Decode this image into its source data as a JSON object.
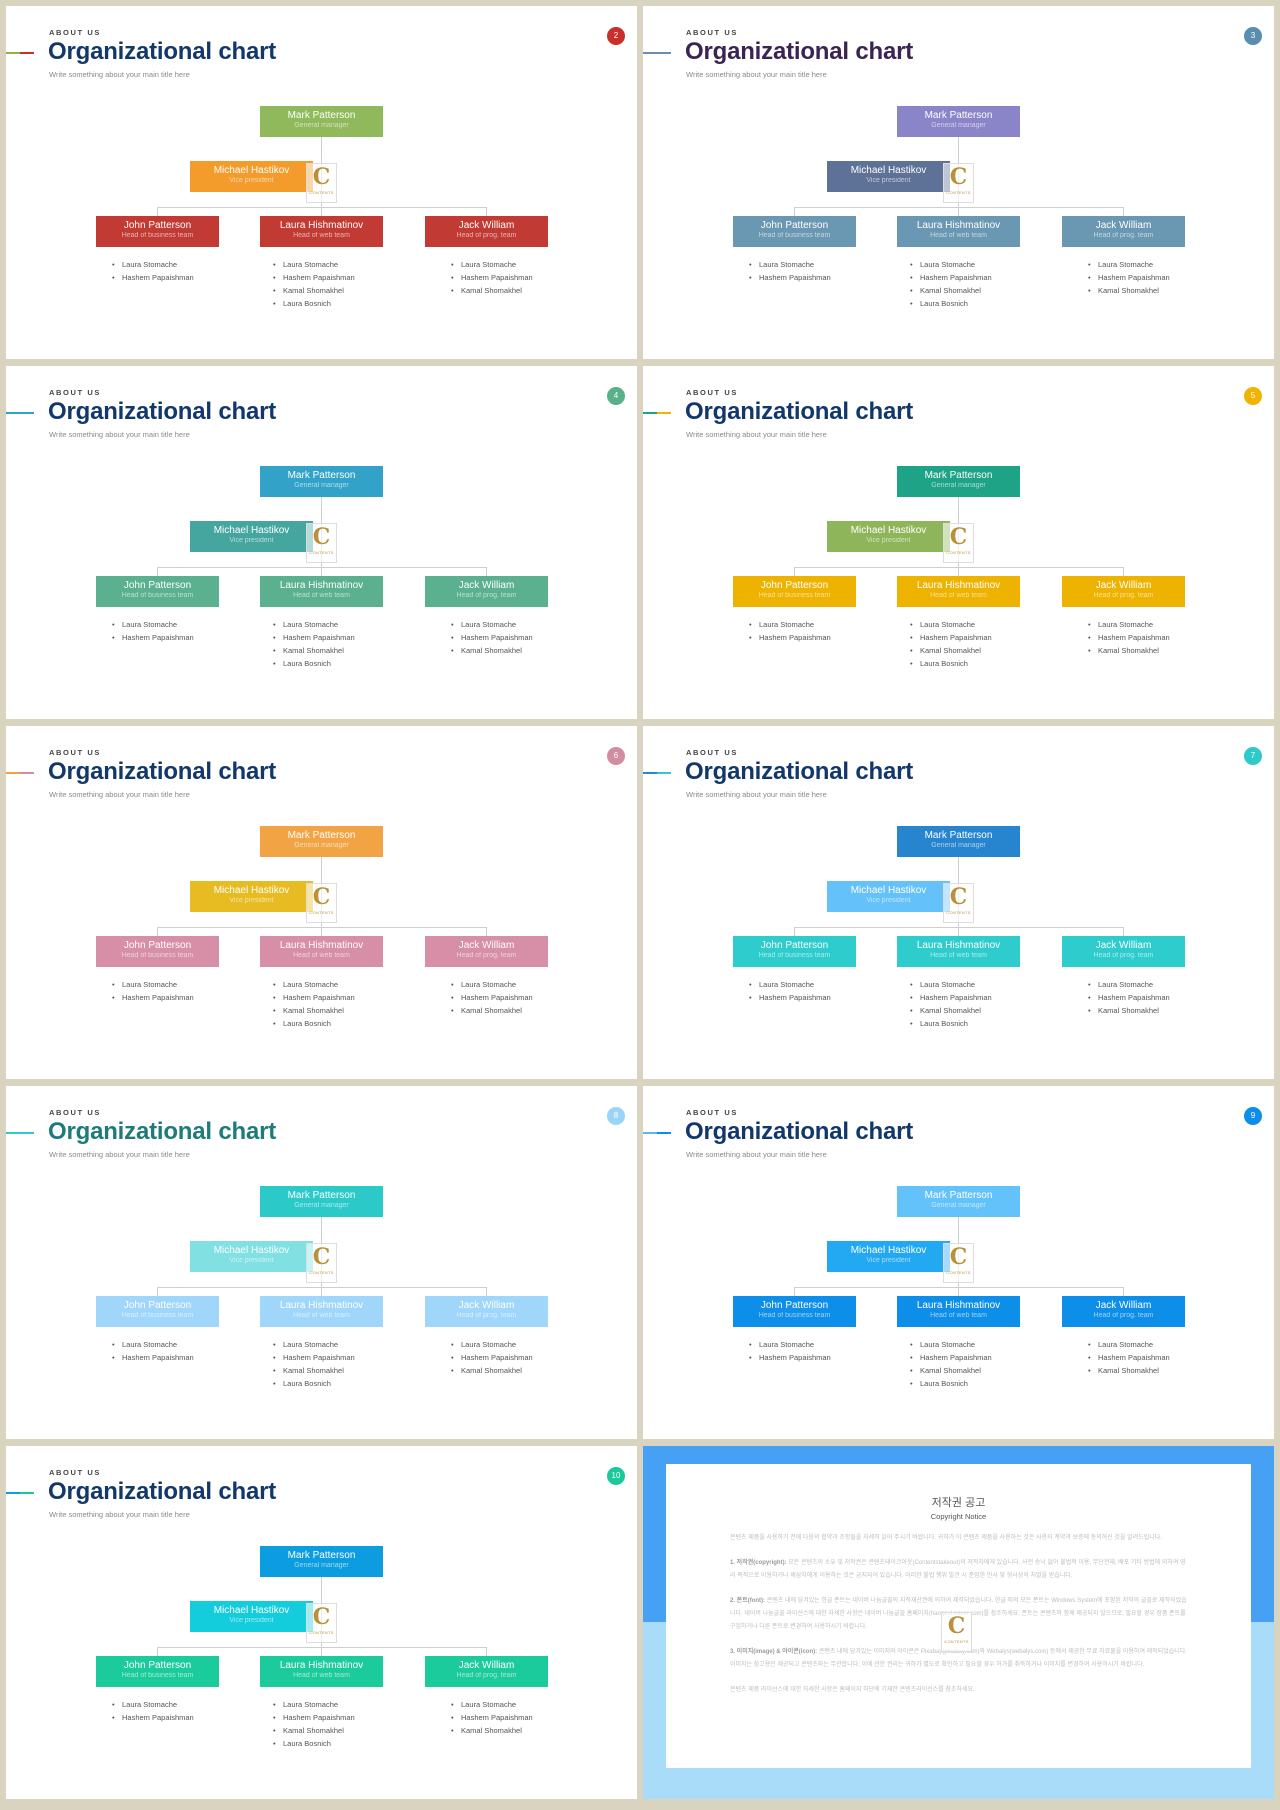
{
  "common": {
    "eyebrow": "ABOUT US",
    "title": "Organizational chart",
    "subtitle": "Write something about your main title here",
    "logo": {
      "icon": "c-monogram-logo",
      "glyph": "C",
      "text": "CONTENTS"
    },
    "org": {
      "general_manager": {
        "name": "Mark Patterson",
        "role": "General manager"
      },
      "vice_president": {
        "name": "Michael Hastikov",
        "role": "Vice president"
      },
      "heads": [
        {
          "name": "John Patterson",
          "role": "Head of business team",
          "members": [
            "Laura Stomache",
            "Hashem Papaishman"
          ]
        },
        {
          "name": "Laura Hishmatinov",
          "role": "Head of web team",
          "members": [
            "Laura Stomache",
            "Hashem Papaishman",
            "Kamal Shomakhel",
            "Laura Bosnich"
          ]
        },
        {
          "name": "Jack William",
          "role": "Head of prog. team",
          "members": [
            "Laura Stomache",
            "Hashem Papaishman",
            "Kamal Shomakhel"
          ]
        }
      ]
    }
  },
  "slides": [
    {
      "page": "2",
      "title_color": "#12386b",
      "badge_color": "#c9302c",
      "accent": [
        "#8fb34a",
        "#c9302c"
      ],
      "gm_color": "#8fb95a",
      "vp_color": "#f39c2c",
      "head_color": "#c13a33"
    },
    {
      "page": "3",
      "title_color": "#3b2352",
      "badge_color": "#5b8db0",
      "accent": [
        "#6a8db0",
        "#6a8db0"
      ],
      "gm_color": "#8a85c9",
      "vp_color": "#5d7296",
      "head_color": "#6a97b2"
    },
    {
      "page": "4",
      "title_color": "#12386b",
      "badge_color": "#5ab08a",
      "accent": [
        "#2fa5c0",
        "#2fa5c0"
      ],
      "gm_color": "#33a2c8",
      "vp_color": "#45a6a0",
      "head_color": "#5ab08f"
    },
    {
      "page": "5",
      "title_color": "#12386b",
      "badge_color": "#f0b400",
      "accent": [
        "#1aa58a",
        "#f0b400"
      ],
      "gm_color": "#1fa386",
      "vp_color": "#8fb55a",
      "head_color": "#eeb200"
    },
    {
      "page": "6",
      "title_color": "#12386b",
      "badge_color": "#d38da3",
      "accent": [
        "#f3a04a",
        "#d38da3"
      ],
      "gm_color": "#f2a444",
      "vp_color": "#e6bc22",
      "head_color": "#d68fa6"
    },
    {
      "page": "7",
      "title_color": "#12386b",
      "badge_color": "#2ec9c9",
      "accent": [
        "#2a86cf",
        "#2ec9c9"
      ],
      "gm_color": "#2785cf",
      "vp_color": "#64c1fa",
      "head_color": "#2ecccc"
    },
    {
      "page": "8",
      "title_color": "#1d7c7a",
      "badge_color": "#9cd4f7",
      "accent": [
        "#34c8c8",
        "#34c8c8"
      ],
      "gm_color": "#2cc9c9",
      "vp_color": "#80e0e2",
      "head_color": "#9fd6f9"
    },
    {
      "page": "9",
      "title_color": "#12386b",
      "badge_color": "#0d8ee8",
      "accent": [
        "#5bb9f0",
        "#0d8ee8"
      ],
      "gm_color": "#64c2fa",
      "vp_color": "#22a9f2",
      "head_color": "#0d8ee8"
    },
    {
      "page": "10",
      "title_color": "#12386b",
      "badge_color": "#19c99a",
      "accent": [
        "#0aa0dd",
        "#19c99a"
      ],
      "gm_color": "#0c9ce0",
      "vp_color": "#14cddc",
      "head_color": "#1ccb9b"
    }
  ],
  "copyright": {
    "title_ko": "저작권 공고",
    "title_en": "Copyright Notice",
    "top_color": "#46a0f3",
    "bottom_color": "#a9dcf8",
    "intro": "콘텐츠 제품을 사용하기 전에 다음의 협약과 조항들을 자세히 읽어 주시기 바랍니다. 귀하가 이 콘텐츠 제품을 사용하는 것은 사용자 계약과 보증에 동의하신 것을 알려드립니다.",
    "sections": [
      {
        "heading": "1. 저작권(copyright):",
        "text": "모든 콘텐츠의 소유 및 저작권은 콘텐츠테이크아웃(Contentstakeout)의 저작자에게 있습니다. 사전 승낙 없이 불법적 이용, 무단전재, 배포 기타 방법에 의하여 영리 목적으로 이용하거나 제삼자에게 이용하는 것은 금지되어 있습니다. 이러한 불법 행위 발견 시 준엄한 민사 및 형사상의 처벌을 받습니다."
      },
      {
        "heading": "2. 폰트(font):",
        "text": "콘텐츠 내에 담겨있는 한글 폰트는 네이버 나눔글꼴의 지적재산권에 의하여 제작되었습니다. 한글 외의 모든 폰트는 Windows System에 포함된 저작의 글꼴로 제작되었습니다. 네이버 나눔글꼴 라이선스에 대한 자세한 사항은 네이버 나눔글꼴 홈페이지(hangeul.naver.com)를 참조하세요. 폰트는 콘텐츠와 함께 제공되지 않으므로, 필요할 경우 정품 폰트를 구입하거나 다른 폰트로 변경하여 사용하시기 바랍니다."
      },
      {
        "heading": "3. 이미지(image) & 아이콘(icon):",
        "text": "콘텐츠 내에 담겨있는 이미지와 아이콘은 Pixabay(pixabay.com)와 Webalys(webalys.com) 등에서 제공한 무료 자료물을 이용하여 제작되었습니다. 이미지는 참고용만 제공되고 콘텐츠와는 무관합니다. 이에 관한 권리는 귀하가 별도로 확인하고 필요할 경우 허가를 취득하거나 이미지를 변경하여 사용하시기 바랍니다."
      }
    ],
    "footer": "콘텐츠 제품 라이선스에 대한 자세한 사항은 홈페이지 하단에 기재한 콘텐츠라이선스를 참조하세요."
  }
}
